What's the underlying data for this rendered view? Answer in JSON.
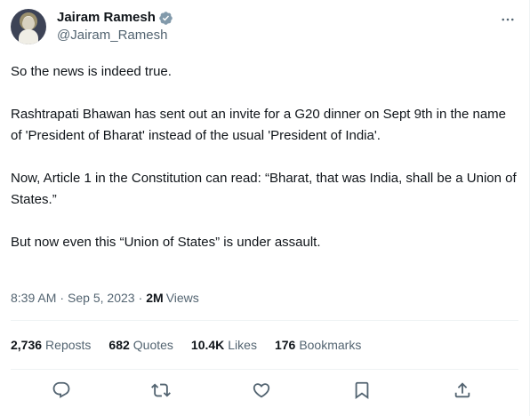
{
  "author": {
    "display_name": "Jairam Ramesh",
    "handle": "@Jairam_Ramesh",
    "verified": true
  },
  "tweet": {
    "paragraphs": [
      "So the news is indeed true.",
      "Rashtrapati Bhawan has sent out an invite for a G20 dinner on Sept 9th in the name of 'President of Bharat' instead of the usual 'President of India'.",
      "Now, Article 1 in the Constitution can read: “Bharat, that was India, shall be a Union of States.”",
      "But now even this “Union of States” is under assault."
    ],
    "time": "8:39 AM",
    "separator": "·",
    "date": "Sep 5, 2023",
    "views_count": "2M",
    "views_label": "Views"
  },
  "stats": {
    "reposts_count": "2,736",
    "reposts_label": "Reposts",
    "quotes_count": "682",
    "quotes_label": "Quotes",
    "likes_count": "10.4K",
    "likes_label": "Likes",
    "bookmarks_count": "176",
    "bookmarks_label": "Bookmarks"
  },
  "icons": {
    "more": "more-horizontal-icon",
    "verified": "verified-badge-icon",
    "reply": "reply-icon",
    "repost": "repost-icon",
    "like": "heart-icon",
    "bookmark": "bookmark-icon",
    "share": "share-icon"
  },
  "colors": {
    "text_primary": "#0f1419",
    "text_secondary": "#536471",
    "divider": "#eff3f4",
    "verified_badge": "#829aab"
  }
}
